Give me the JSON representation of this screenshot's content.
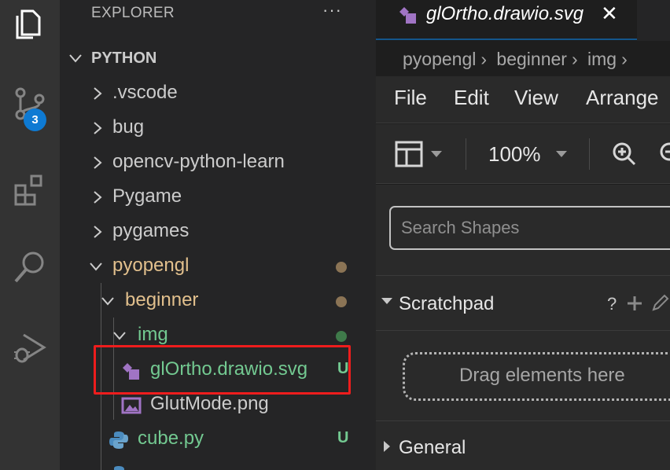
{
  "sidebar": {
    "header": "EXPLORER",
    "more": "···",
    "section_title": "PYTHON",
    "items": [
      {
        "label": ".vscode",
        "type": "folder",
        "expanded": false
      },
      {
        "label": "bug",
        "type": "folder",
        "expanded": false
      },
      {
        "label": "opencv-python-learn",
        "type": "folder",
        "expanded": false
      },
      {
        "label": "Pygame",
        "type": "folder",
        "expanded": false
      },
      {
        "label": "pygames",
        "type": "folder",
        "expanded": false
      },
      {
        "label": "pyopengl",
        "type": "folder",
        "expanded": true,
        "decoration": "modified-dot"
      },
      {
        "label": "beginner",
        "type": "folder",
        "expanded": true,
        "decoration": "modified-dot"
      },
      {
        "label": "img",
        "type": "folder",
        "expanded": true,
        "decoration": "untracked-dot"
      },
      {
        "label": "glOrtho.drawio.svg",
        "type": "file",
        "icon": "drawio-icon",
        "status": "U",
        "selected": true
      },
      {
        "label": "GlutMode.png",
        "type": "file",
        "icon": "image-icon"
      },
      {
        "label": "cube.py",
        "type": "file",
        "icon": "python-icon",
        "status": "U"
      }
    ]
  },
  "activity_bar": {
    "icons": [
      "explorer-icon",
      "source-control-icon",
      "extensions-icon",
      "search-icon",
      "run-debug-icon"
    ],
    "source_control_badge": "3"
  },
  "editor": {
    "tab": {
      "label": "glOrtho.drawio.svg",
      "close": "✕"
    },
    "breadcrumb": [
      "pyopengl",
      "beginner",
      "img"
    ],
    "menu": [
      "File",
      "Edit",
      "View",
      "Arrange"
    ],
    "toolbar": {
      "zoom": "100%"
    },
    "shapes": {
      "search_placeholder": "Search Shapes",
      "scratchpad_title": "Scratchpad",
      "scratchpad_help": "?",
      "drag_hint": "Drag elements here",
      "general_title": "General"
    }
  },
  "colors": {
    "modified_dot": "#8b7455",
    "untracked_dot": "#3f7a4a",
    "untracked_text": "#73c991",
    "folder_modified_text": "#e2c08d",
    "accent": "#0e7ad3",
    "highlight_box": "#ee1d1d"
  }
}
